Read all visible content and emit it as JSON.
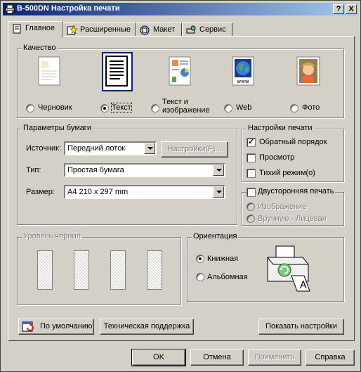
{
  "window": {
    "title": "B-500DN Настройка печати",
    "help_btn": "?",
    "close_btn": "X"
  },
  "tabs": [
    "Главное",
    "Расширенные",
    "Макет",
    "Сервис"
  ],
  "quality": {
    "title": "Качество",
    "options": [
      "Черновик",
      "Текст",
      "Текст и\nизображение",
      "Web",
      "Фото"
    ],
    "selected": "Текст"
  },
  "paper": {
    "title": "Параметры бумаги",
    "source_label": "Источник:",
    "source_value": "Передний лоток",
    "settings_btn": "Настройки(F)...",
    "type_label": "Тип:",
    "type_value": "Простая бумага",
    "size_label": "Размер:",
    "size_value": "A4 210 x 297 mm"
  },
  "print_settings": {
    "title": "Настройки печати",
    "reverse": "Обратный порядок",
    "reverse_checked": true,
    "preview": "Просмотр",
    "preview_checked": false,
    "quiet": "Тихий режим(o)",
    "quiet_checked": false
  },
  "duplex": {
    "title": "Двусторонняя печать",
    "opt1": "Изображение",
    "opt2": "Вручную - Лицевая"
  },
  "ink": {
    "title": "Уровень чернил"
  },
  "orientation": {
    "title": "Ориентация",
    "portrait": "Книжная",
    "landscape": "Альбомная",
    "selected": "Книжная"
  },
  "buttons": {
    "defaults": "По умолчанию",
    "support": "Техническая поддержка",
    "show_settings": "Показать настройки",
    "ok": "OK",
    "cancel": "Отмена",
    "apply": "Применить",
    "help": "Справка"
  },
  "colors": {
    "title_start": "#0a246a",
    "title_end": "#a6caf0",
    "face": "#d4d0c8"
  }
}
